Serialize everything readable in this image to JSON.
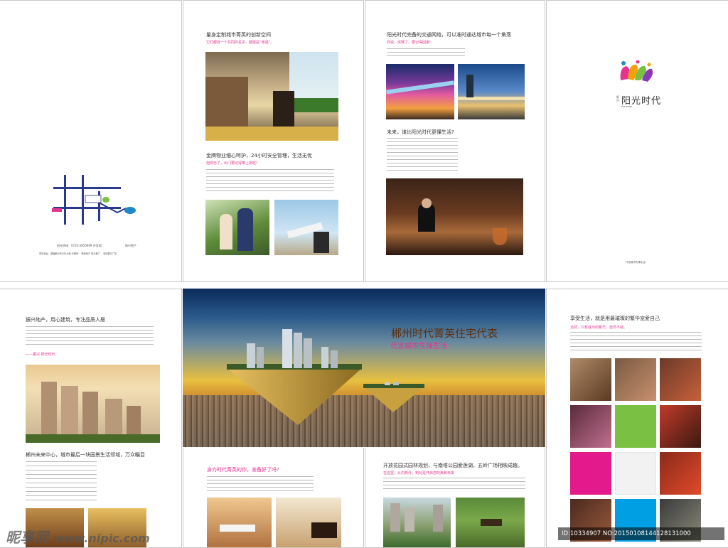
{
  "top": {
    "map_page": {
      "hotline": "阳光热线：0735-2850999 开发商：",
      "developer": "振兴地产",
      "footer": "项目地址：湖南郴州市青年大道   代理商：   策划地产   营业推广：   深圳垂青广告",
      "map_labels": [
        "振兴地产",
        "阳光时代"
      ]
    },
    "page2": {
      "title": "量身定制城市菁英的创新空间",
      "subtitle": "它们都有一个共同的名字，都能是“幸福”。",
      "title2": "金牌物业细心呵护，24小时安全管理，生活无忧",
      "subtitle2": "但则忘了，出门要记得带上钥匙!"
    },
    "page3": {
      "title": "阳光时代完备的交通网络，可以准时通达城市每一个角落",
      "subtitle": "你说，成够了，要记得回家!",
      "title2": "未来，谁比阳光时代更懂生活?"
    },
    "cover": {
      "logo_main": "阳光时代",
      "logo_prefix": "振兴",
      "logo_en": "SUN TIMES",
      "note": "代言城市先锋生活"
    }
  },
  "bottom": {
    "page5": {
      "title": "振兴地产，用心建筑，专注品质人居",
      "slogan": "——振兴·阳光时代",
      "title2": "郴州未来中心，城市最后一块园景生活领域，万众瞩目"
    },
    "spread": {
      "headline": "郴州时代菁英住宅代表",
      "subheadline": "代言城市先锋生活"
    },
    "page6": {
      "title": "身为时代菁英的你，准备好了吗?"
    },
    "page7": {
      "title": "开放花园式园林规划，与南塔公园爱莲湖，五岭广场相映成趣。",
      "subtitle": "在这里，从内到外，到处是开启您的美和未来"
    },
    "page8": {
      "title": "享受生活，就是用最璀璨的繁华宠爱自己",
      "subtitle": "当然，只有成为的繁华，自然不晓。"
    }
  },
  "watermark": {
    "logo": "昵享网",
    "url": "www.nipic.com",
    "id": "ID:10334907 NO:20150108144128131000"
  },
  "colors": {
    "accent_pink": "#e5338f",
    "grid": [
      "#7a5a40",
      "#b08a6a",
      "#6a3a2a",
      "#5a2a3a",
      "#7ac143",
      "#c23a2a",
      "#e21a8c",
      "#f2f2f2",
      "#8a2a1a",
      "#4a2a20",
      "#009fe3",
      "#3a3a3a"
    ]
  }
}
